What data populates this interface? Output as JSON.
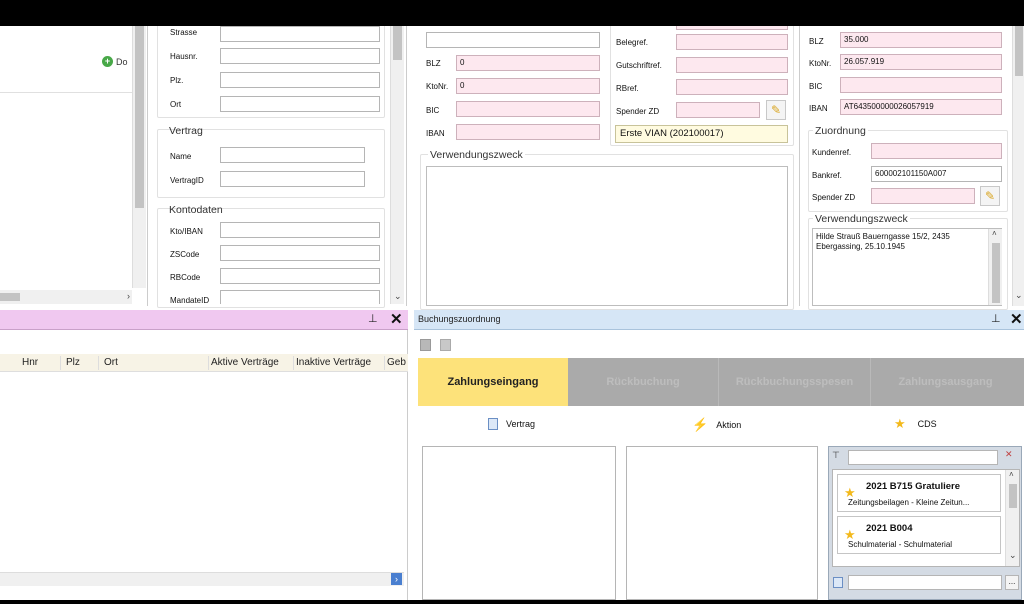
{
  "customer": {
    "address": {
      "street_label": "Strasse",
      "house_label": "Hausnr.",
      "zip_label": "Plz.",
      "city_label": "Ort"
    },
    "contract": {
      "title": "Vertrag",
      "name_label": "Name",
      "id_label": "VertragID"
    },
    "account": {
      "title": "Kontodaten",
      "iban_label": "Kto/IBAN",
      "zs_label": "ZSCode",
      "rb_label": "RBCode",
      "mandate_label": "MandateID"
    },
    "left_link": "Do"
  },
  "middle": {
    "blz_label": "BLZ",
    "blz_value": "0",
    "kto_label": "KtoNr.",
    "kto_value": "0",
    "bic_label": "BIC",
    "iban_label": "IBAN",
    "belegref_label": "Belegref.",
    "gutschrift_label": "Gutschriftref.",
    "rbref_label": "RBref.",
    "spender_label": "Spender ZD",
    "suggestion": "Erste VIAN (202100017)",
    "verwendungszweck_title": "Verwendungszweck"
  },
  "right": {
    "blz_label": "BLZ",
    "blz_value": "35.000",
    "kto_label": "KtoNr.",
    "kto_value": "26.057.919",
    "bic_label": "BIC",
    "iban_label": "IBAN",
    "iban_value": "AT643500000026057919",
    "zuordnung_title": "Zuordnung",
    "kundenref_label": "Kundenref.",
    "bankref_label": "Bankref.",
    "bankref_value": "600002101150A007",
    "spender_label": "Spender ZD",
    "verwendungszweck_title": "Verwendungszweck",
    "verwendungszweck_text": "Hilde Strauß Bauerngasse 15/2, 2435 Ebergassing, 25.10.1945"
  },
  "customer_list": {
    "columns": [
      "Hnr",
      "Plz",
      "Ort",
      "Aktive Verträge",
      "Inaktive Verträge",
      "Geb"
    ]
  },
  "booking": {
    "title": "Buchungszuordnung",
    "tabs": [
      "Zahlungseingang",
      "Rückbuchung",
      "Rückbuchungsspesen",
      "Zahlungsausgang"
    ],
    "sections": {
      "vertrag": "Vertrag",
      "aktion": "Aktion",
      "cds": "CDS"
    },
    "cds_items": [
      {
        "title": "2021 B715 Gratuliere",
        "subtitle": "Zeitungsbeilagen - Kleine Zeitun..."
      },
      {
        "title": "2021 B004",
        "subtitle": "Schulmaterial - Schulmaterial"
      }
    ],
    "more_button": "..."
  },
  "colors": {
    "pink_field": "#fde8ef",
    "active_tab": "#fde27a",
    "inactive_tab": "#aaaaaa",
    "pane_header_pink": "#f0c8f0",
    "pane_header_blue": "#d6e6f6",
    "star": "#f3b91c"
  }
}
